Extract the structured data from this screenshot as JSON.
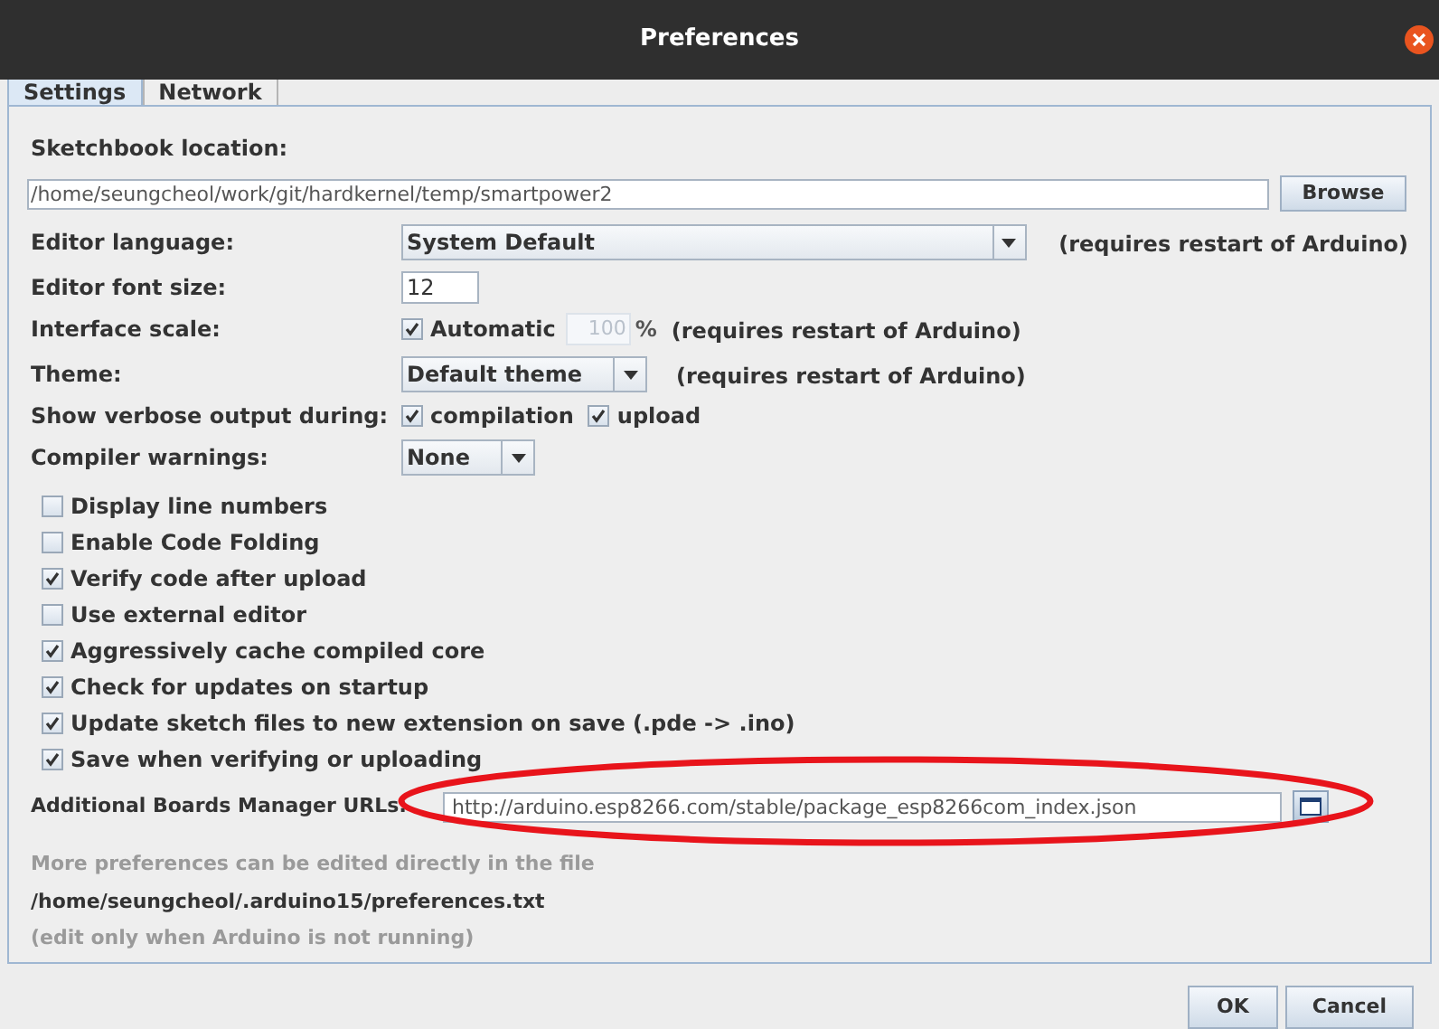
{
  "window": {
    "title": "Preferences"
  },
  "tabs": [
    {
      "label": "Settings",
      "selected": true
    },
    {
      "label": "Network",
      "selected": false
    }
  ],
  "sketchbook": {
    "label": "Sketchbook location:",
    "value": "/home/seungcheol/work/git/hardkernel/temp/smartpower2",
    "button": "Browse"
  },
  "editor_language": {
    "label": "Editor language:",
    "value": "System Default",
    "note": "(requires restart of Arduino)"
  },
  "font_size": {
    "label": "Editor font size:",
    "value": "12"
  },
  "interface_scale": {
    "label": "Interface scale:",
    "automatic": {
      "label": "Automatic",
      "checked": true
    },
    "value": "100",
    "disabled": true,
    "unit": "%",
    "note": "(requires restart of Arduino)"
  },
  "theme": {
    "label": "Theme:",
    "value": "Default theme",
    "note": "(requires restart of Arduino)"
  },
  "verbose": {
    "label": "Show verbose output during:",
    "options": [
      {
        "label": "compilation",
        "checked": true
      },
      {
        "label": "upload",
        "checked": true
      }
    ]
  },
  "compiler_warnings": {
    "label": "Compiler warnings:",
    "value": "None"
  },
  "checkboxes": [
    {
      "label": "Display line numbers",
      "checked": false
    },
    {
      "label": "Enable Code Folding",
      "checked": false
    },
    {
      "label": "Verify code after upload",
      "checked": true
    },
    {
      "label": "Use external editor",
      "checked": false
    },
    {
      "label": "Aggressively cache compiled core",
      "checked": true
    },
    {
      "label": "Check for updates on startup",
      "checked": true
    },
    {
      "label": "Update sketch files to new extension on save (.pde -> .ino)",
      "checked": true
    },
    {
      "label": "Save when verifying or uploading",
      "checked": true
    }
  ],
  "boards_urls": {
    "label": "Additional Boards Manager URLs:",
    "value": "http://arduino.esp8266.com/stable/package_esp8266com_index.json"
  },
  "footer": {
    "hint": "More preferences can be edited directly in the file",
    "path": "/home/seungcheol/.arduino15/preferences.txt",
    "note": "(edit only when Arduino is not running)"
  },
  "buttons": [
    "OK",
    "Cancel"
  ],
  "annotations": [
    {
      "kind": "ellipse",
      "color": "#e8141b"
    }
  ]
}
